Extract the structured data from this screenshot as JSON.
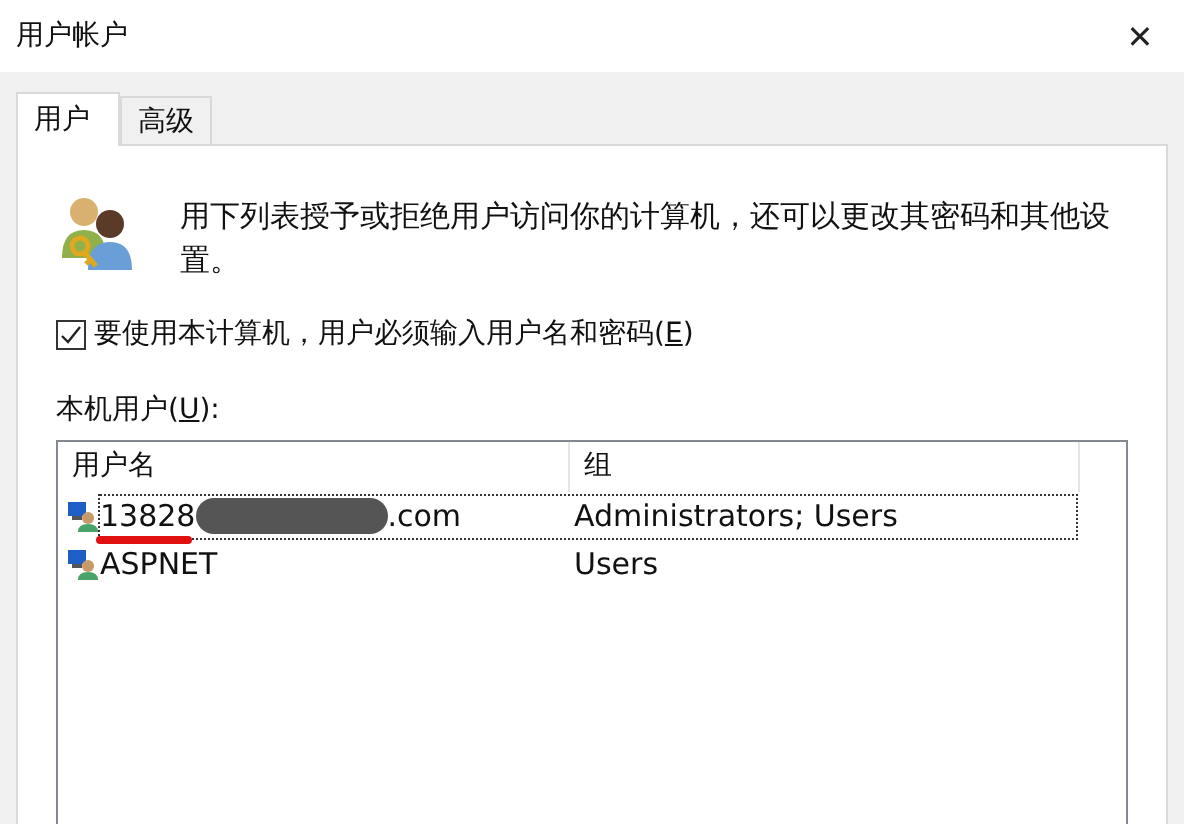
{
  "window": {
    "title": "用户帐户",
    "close": "✕"
  },
  "tabs": [
    {
      "label": "用户",
      "selected": true
    },
    {
      "label": "高级",
      "selected": false
    }
  ],
  "description": "用下列表授予或拒绝用户访问你的计算机，还可以更改其密码和其他设置。",
  "require_password": {
    "before": "要使用本计算机，用户必须输入用户名和密码(",
    "key": "E",
    "after": ")",
    "checked": true
  },
  "users_label": {
    "before": "本机用户(",
    "key": "U",
    "after": "):"
  },
  "table": {
    "columns": [
      "用户名",
      "组"
    ],
    "rows": [
      {
        "name_start": "13828",
        "name_end": ".com",
        "redacted": true,
        "group": "Administrators; Users",
        "selected": true
      },
      {
        "name_start": "ASPNET",
        "group": "Users",
        "selected": false,
        "redacted": false
      }
    ]
  }
}
